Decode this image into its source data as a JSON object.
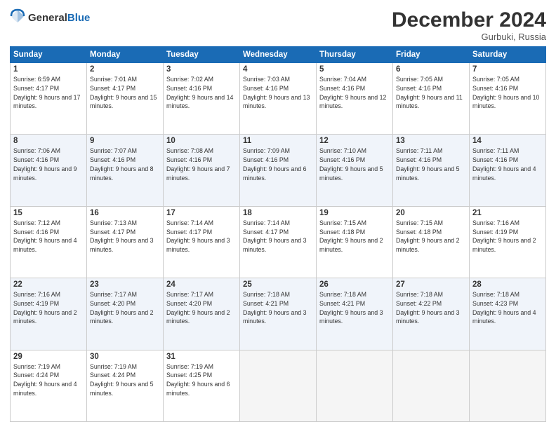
{
  "header": {
    "logo_general": "General",
    "logo_blue": "Blue",
    "month": "December 2024",
    "location": "Gurbuki, Russia"
  },
  "weekdays": [
    "Sunday",
    "Monday",
    "Tuesday",
    "Wednesday",
    "Thursday",
    "Friday",
    "Saturday"
  ],
  "weeks": [
    [
      {
        "day": "1",
        "sunrise": "Sunrise: 6:59 AM",
        "sunset": "Sunset: 4:17 PM",
        "daylight": "Daylight: 9 hours and 17 minutes."
      },
      {
        "day": "2",
        "sunrise": "Sunrise: 7:01 AM",
        "sunset": "Sunset: 4:17 PM",
        "daylight": "Daylight: 9 hours and 15 minutes."
      },
      {
        "day": "3",
        "sunrise": "Sunrise: 7:02 AM",
        "sunset": "Sunset: 4:16 PM",
        "daylight": "Daylight: 9 hours and 14 minutes."
      },
      {
        "day": "4",
        "sunrise": "Sunrise: 7:03 AM",
        "sunset": "Sunset: 4:16 PM",
        "daylight": "Daylight: 9 hours and 13 minutes."
      },
      {
        "day": "5",
        "sunrise": "Sunrise: 7:04 AM",
        "sunset": "Sunset: 4:16 PM",
        "daylight": "Daylight: 9 hours and 12 minutes."
      },
      {
        "day": "6",
        "sunrise": "Sunrise: 7:05 AM",
        "sunset": "Sunset: 4:16 PM",
        "daylight": "Daylight: 9 hours and 11 minutes."
      },
      {
        "day": "7",
        "sunrise": "Sunrise: 7:05 AM",
        "sunset": "Sunset: 4:16 PM",
        "daylight": "Daylight: 9 hours and 10 minutes."
      }
    ],
    [
      {
        "day": "8",
        "sunrise": "Sunrise: 7:06 AM",
        "sunset": "Sunset: 4:16 PM",
        "daylight": "Daylight: 9 hours and 9 minutes."
      },
      {
        "day": "9",
        "sunrise": "Sunrise: 7:07 AM",
        "sunset": "Sunset: 4:16 PM",
        "daylight": "Daylight: 9 hours and 8 minutes."
      },
      {
        "day": "10",
        "sunrise": "Sunrise: 7:08 AM",
        "sunset": "Sunset: 4:16 PM",
        "daylight": "Daylight: 9 hours and 7 minutes."
      },
      {
        "day": "11",
        "sunrise": "Sunrise: 7:09 AM",
        "sunset": "Sunset: 4:16 PM",
        "daylight": "Daylight: 9 hours and 6 minutes."
      },
      {
        "day": "12",
        "sunrise": "Sunrise: 7:10 AM",
        "sunset": "Sunset: 4:16 PM",
        "daylight": "Daylight: 9 hours and 5 minutes."
      },
      {
        "day": "13",
        "sunrise": "Sunrise: 7:11 AM",
        "sunset": "Sunset: 4:16 PM",
        "daylight": "Daylight: 9 hours and 5 minutes."
      },
      {
        "day": "14",
        "sunrise": "Sunrise: 7:11 AM",
        "sunset": "Sunset: 4:16 PM",
        "daylight": "Daylight: 9 hours and 4 minutes."
      }
    ],
    [
      {
        "day": "15",
        "sunrise": "Sunrise: 7:12 AM",
        "sunset": "Sunset: 4:16 PM",
        "daylight": "Daylight: 9 hours and 4 minutes."
      },
      {
        "day": "16",
        "sunrise": "Sunrise: 7:13 AM",
        "sunset": "Sunset: 4:17 PM",
        "daylight": "Daylight: 9 hours and 3 minutes."
      },
      {
        "day": "17",
        "sunrise": "Sunrise: 7:14 AM",
        "sunset": "Sunset: 4:17 PM",
        "daylight": "Daylight: 9 hours and 3 minutes."
      },
      {
        "day": "18",
        "sunrise": "Sunrise: 7:14 AM",
        "sunset": "Sunset: 4:17 PM",
        "daylight": "Daylight: 9 hours and 3 minutes."
      },
      {
        "day": "19",
        "sunrise": "Sunrise: 7:15 AM",
        "sunset": "Sunset: 4:18 PM",
        "daylight": "Daylight: 9 hours and 2 minutes."
      },
      {
        "day": "20",
        "sunrise": "Sunrise: 7:15 AM",
        "sunset": "Sunset: 4:18 PM",
        "daylight": "Daylight: 9 hours and 2 minutes."
      },
      {
        "day": "21",
        "sunrise": "Sunrise: 7:16 AM",
        "sunset": "Sunset: 4:19 PM",
        "daylight": "Daylight: 9 hours and 2 minutes."
      }
    ],
    [
      {
        "day": "22",
        "sunrise": "Sunrise: 7:16 AM",
        "sunset": "Sunset: 4:19 PM",
        "daylight": "Daylight: 9 hours and 2 minutes."
      },
      {
        "day": "23",
        "sunrise": "Sunrise: 7:17 AM",
        "sunset": "Sunset: 4:20 PM",
        "daylight": "Daylight: 9 hours and 2 minutes."
      },
      {
        "day": "24",
        "sunrise": "Sunrise: 7:17 AM",
        "sunset": "Sunset: 4:20 PM",
        "daylight": "Daylight: 9 hours and 2 minutes."
      },
      {
        "day": "25",
        "sunrise": "Sunrise: 7:18 AM",
        "sunset": "Sunset: 4:21 PM",
        "daylight": "Daylight: 9 hours and 3 minutes."
      },
      {
        "day": "26",
        "sunrise": "Sunrise: 7:18 AM",
        "sunset": "Sunset: 4:21 PM",
        "daylight": "Daylight: 9 hours and 3 minutes."
      },
      {
        "day": "27",
        "sunrise": "Sunrise: 7:18 AM",
        "sunset": "Sunset: 4:22 PM",
        "daylight": "Daylight: 9 hours and 3 minutes."
      },
      {
        "day": "28",
        "sunrise": "Sunrise: 7:18 AM",
        "sunset": "Sunset: 4:23 PM",
        "daylight": "Daylight: 9 hours and 4 minutes."
      }
    ],
    [
      {
        "day": "29",
        "sunrise": "Sunrise: 7:19 AM",
        "sunset": "Sunset: 4:24 PM",
        "daylight": "Daylight: 9 hours and 4 minutes."
      },
      {
        "day": "30",
        "sunrise": "Sunrise: 7:19 AM",
        "sunset": "Sunset: 4:24 PM",
        "daylight": "Daylight: 9 hours and 5 minutes."
      },
      {
        "day": "31",
        "sunrise": "Sunrise: 7:19 AM",
        "sunset": "Sunset: 4:25 PM",
        "daylight": "Daylight: 9 hours and 6 minutes."
      },
      null,
      null,
      null,
      null
    ]
  ]
}
